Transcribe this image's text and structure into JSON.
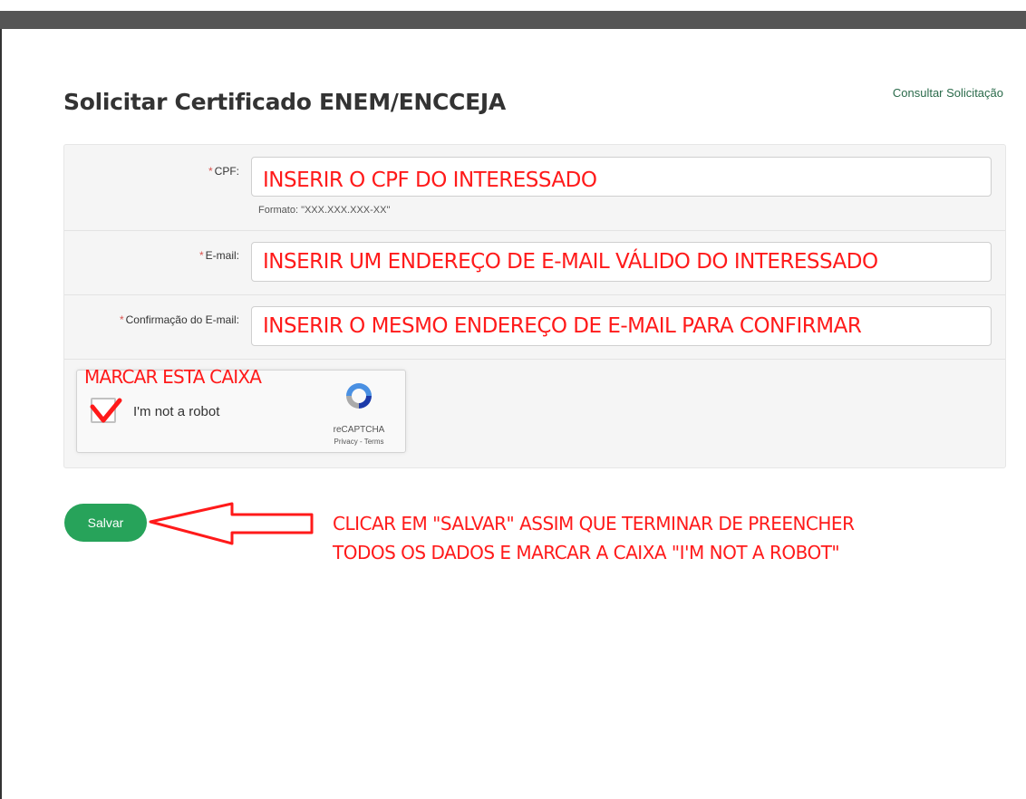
{
  "page": {
    "title": "Solicitar Certificado ENEM/ENCCEJA",
    "consult_link": "Consultar Solicitação"
  },
  "form": {
    "cpf": {
      "required_mark": "*",
      "label": "CPF:",
      "value": "INSERIR O CPF DO INTERESSADO",
      "format_hint": "Formato: \"XXX.XXX.XXX-XX\""
    },
    "email": {
      "required_mark": "*",
      "label": "E-mail:",
      "value": "INSERIR UM ENDEREÇO DE E-MAIL VÁLIDO DO INTERESSADO"
    },
    "email_confirm": {
      "required_mark": "*",
      "label": "Confirmação do E-mail:",
      "value": "INSERIR O MESMO ENDEREÇO DE E-MAIL PARA CONFIRMAR"
    },
    "recaptcha": {
      "checkbox_label": "I'm not a robot",
      "brand": "reCAPTCHA",
      "links": "Privacy - Terms",
      "checked": true
    },
    "save_label": "Salvar"
  },
  "annotations": {
    "check_box_note": "MARCAR ESTA CAIXA",
    "save_note_line1": "CLICAR EM \"SALVAR\" ASSIM QUE TERMINAR DE PREENCHER",
    "save_note_line2": "TODOS OS DADOS E MARCAR A CAIXA \"I'M NOT A ROBOT\""
  },
  "icons": {
    "recaptcha_logo": "recaptcha-logo-icon",
    "checkmark": "checkmark-icon",
    "arrow": "arrow-left-icon"
  },
  "colors": {
    "accent_green": "#27a35a",
    "annotation_red": "#ff1a1a",
    "link_green": "#2a6a4a"
  }
}
